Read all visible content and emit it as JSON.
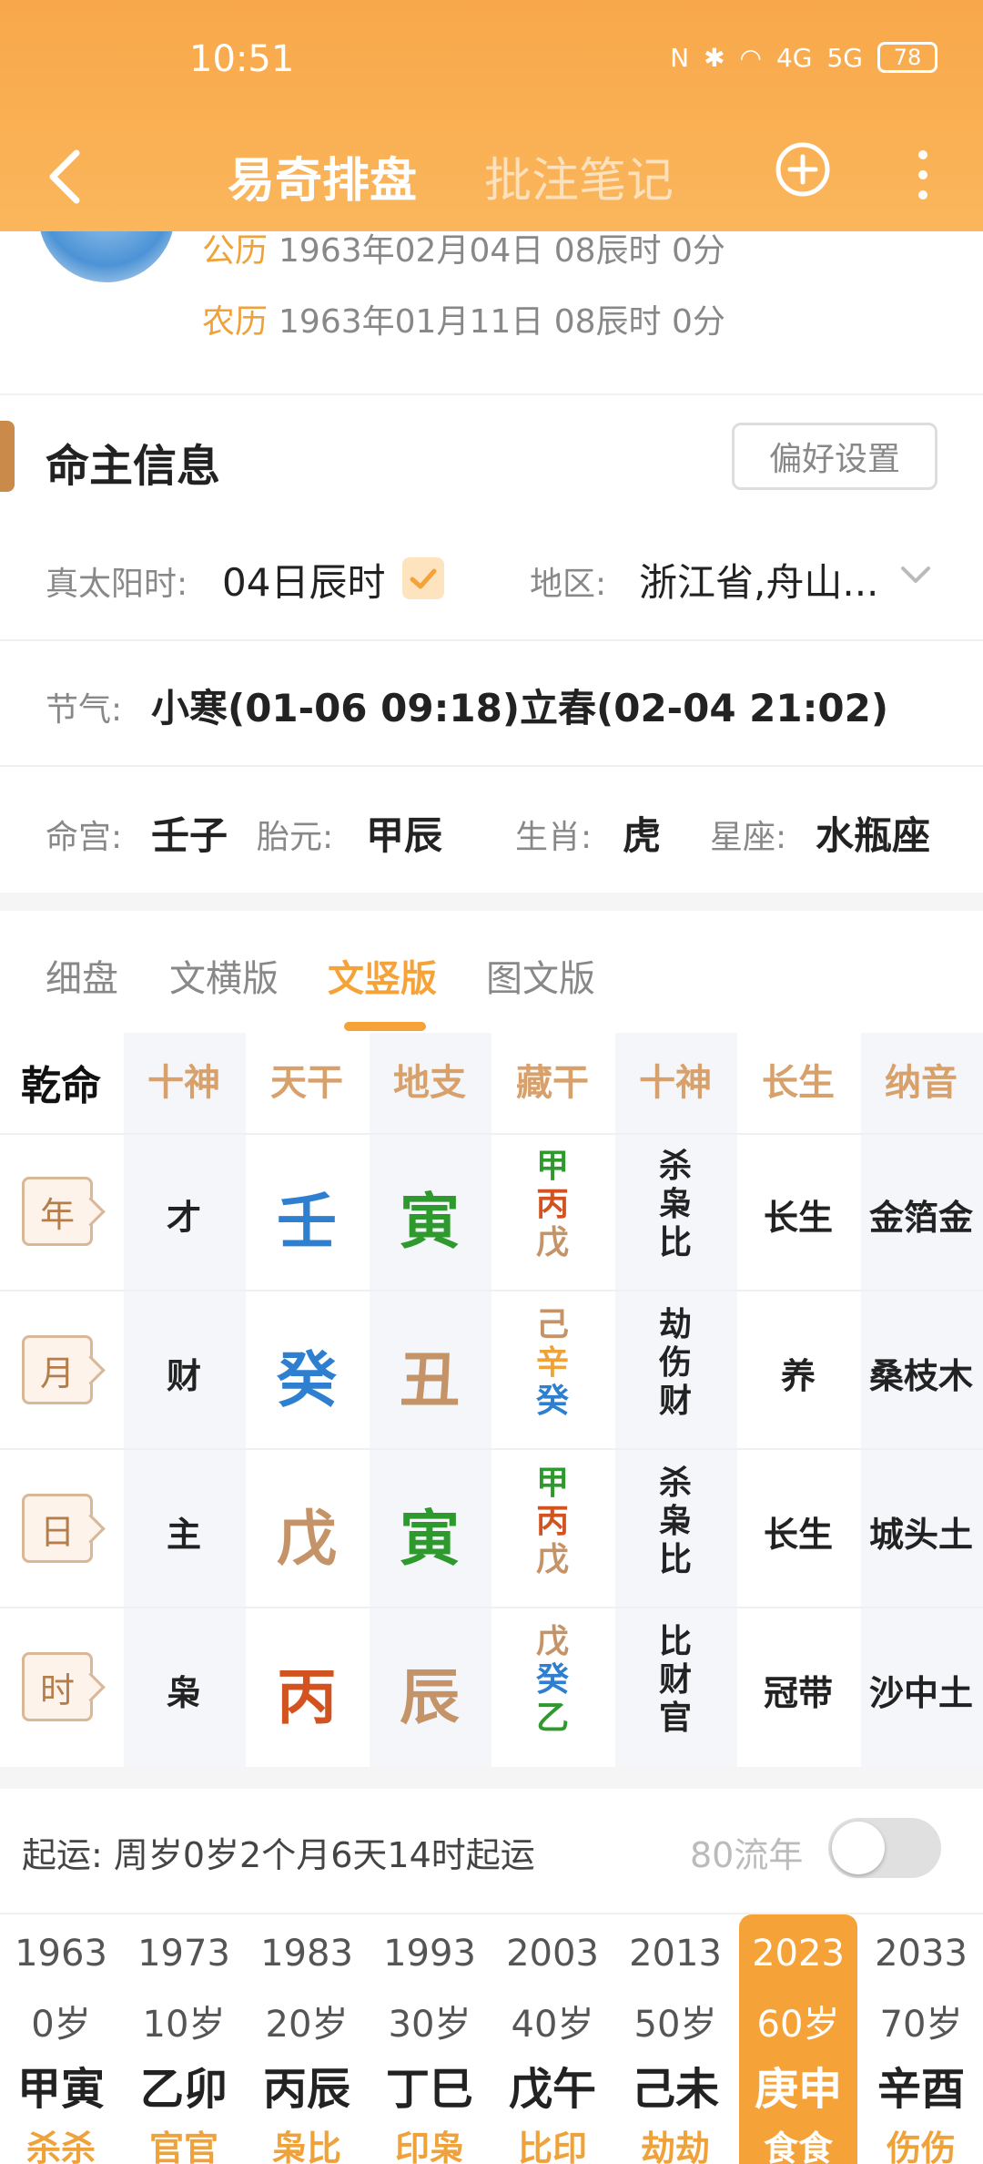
{
  "status": {
    "time": "10:51",
    "battery": "78",
    "net1": "4G",
    "net2": "5G"
  },
  "nav": {
    "title": "易奇排盘",
    "notes_tab": "批注笔记"
  },
  "profile": {
    "solar_label": "公历",
    "solar_value": "1963年02月04日 08辰时 0分",
    "lunar_label": "农历",
    "lunar_value": "1963年01月11日 08辰时 0分"
  },
  "info": {
    "title": "命主信息",
    "pref_button": "偏好设置",
    "true_solar_label": "真太阳时:",
    "true_solar_value": "04日辰时",
    "region_label": "地区:",
    "region_value": "浙江省,舟山...",
    "jieqi_label": "节气:",
    "jieqi_value": "小寒(01-06 09:18)立春(02-04 21:02)",
    "minggong_label": "命宫:",
    "minggong_value": "壬子",
    "taiyuan_label": "胎元:",
    "taiyuan_value": "甲辰",
    "shengxiao_label": "生肖:",
    "shengxiao_value": "虎",
    "xingzuo_label": "星座:",
    "xingzuo_value": "水瓶座"
  },
  "tabs": [
    "细盘",
    "文横版",
    "文竖版",
    "图文版"
  ],
  "active_tab": "文竖版",
  "grid": {
    "first_header": "乾命",
    "headers": [
      "十神",
      "天干",
      "地支",
      "藏干",
      "十神",
      "长生",
      "纳音"
    ],
    "rows": [
      {
        "pillar": "年",
        "god": "才",
        "stem": "壬",
        "stem_color": "#2f7fd0",
        "branch": "寅",
        "branch_color": "#2e9a2e",
        "hidden": [
          {
            "c": "甲",
            "col": "#2e9a2e"
          },
          {
            "c": "丙",
            "col": "#d2531f"
          },
          {
            "c": "戊",
            "col": "#c49468"
          }
        ],
        "hidden_gods": [
          "杀",
          "枭",
          "比"
        ],
        "changsheng": "长生",
        "nayin": "金箔金"
      },
      {
        "pillar": "月",
        "god": "财",
        "stem": "癸",
        "stem_color": "#2f7fd0",
        "branch": "丑",
        "branch_color": "#c49468",
        "hidden": [
          {
            "c": "己",
            "col": "#c49468"
          },
          {
            "c": "辛",
            "col": "#f0a23a"
          },
          {
            "c": "癸",
            "col": "#2f7fd0"
          }
        ],
        "hidden_gods": [
          "劫",
          "伤",
          "财"
        ],
        "changsheng": "养",
        "nayin": "桑枝木"
      },
      {
        "pillar": "日",
        "god": "主",
        "stem": "戊",
        "stem_color": "#c49468",
        "branch": "寅",
        "branch_color": "#2e9a2e",
        "hidden": [
          {
            "c": "甲",
            "col": "#2e9a2e"
          },
          {
            "c": "丙",
            "col": "#d2531f"
          },
          {
            "c": "戊",
            "col": "#c49468"
          }
        ],
        "hidden_gods": [
          "杀",
          "枭",
          "比"
        ],
        "changsheng": "长生",
        "nayin": "城头土"
      },
      {
        "pillar": "时",
        "god": "枭",
        "stem": "丙",
        "stem_color": "#d2531f",
        "branch": "辰",
        "branch_color": "#c49468",
        "hidden": [
          {
            "c": "戊",
            "col": "#c49468"
          },
          {
            "c": "癸",
            "col": "#2f7fd0"
          },
          {
            "c": "乙",
            "col": "#2e9a2e"
          }
        ],
        "hidden_gods": [
          "比",
          "财",
          "官"
        ],
        "changsheng": "冠带",
        "nayin": "沙中土"
      }
    ]
  },
  "luck": {
    "start_text": "起运:  周岁0岁2个月6天14时起运",
    "liunian_label": "80流年",
    "dayun": [
      {
        "year": "1963",
        "age": "0岁",
        "gz": "甲寅",
        "god": "杀杀"
      },
      {
        "year": "1973",
        "age": "10岁",
        "gz": "乙卯",
        "god": "官官"
      },
      {
        "year": "1983",
        "age": "20岁",
        "gz": "丙辰",
        "god": "枭比"
      },
      {
        "year": "1993",
        "age": "30岁",
        "gz": "丁巳",
        "god": "印枭"
      },
      {
        "year": "2003",
        "age": "40岁",
        "gz": "戊午",
        "god": "比印"
      },
      {
        "year": "2013",
        "age": "50岁",
        "gz": "己未",
        "god": "劫劫"
      },
      {
        "year": "2023",
        "age": "60岁",
        "gz": "庚申",
        "god": "食食",
        "active": true
      },
      {
        "year": "2033",
        "age": "70岁",
        "gz": "辛酉",
        "god": "伤伤"
      }
    ]
  }
}
